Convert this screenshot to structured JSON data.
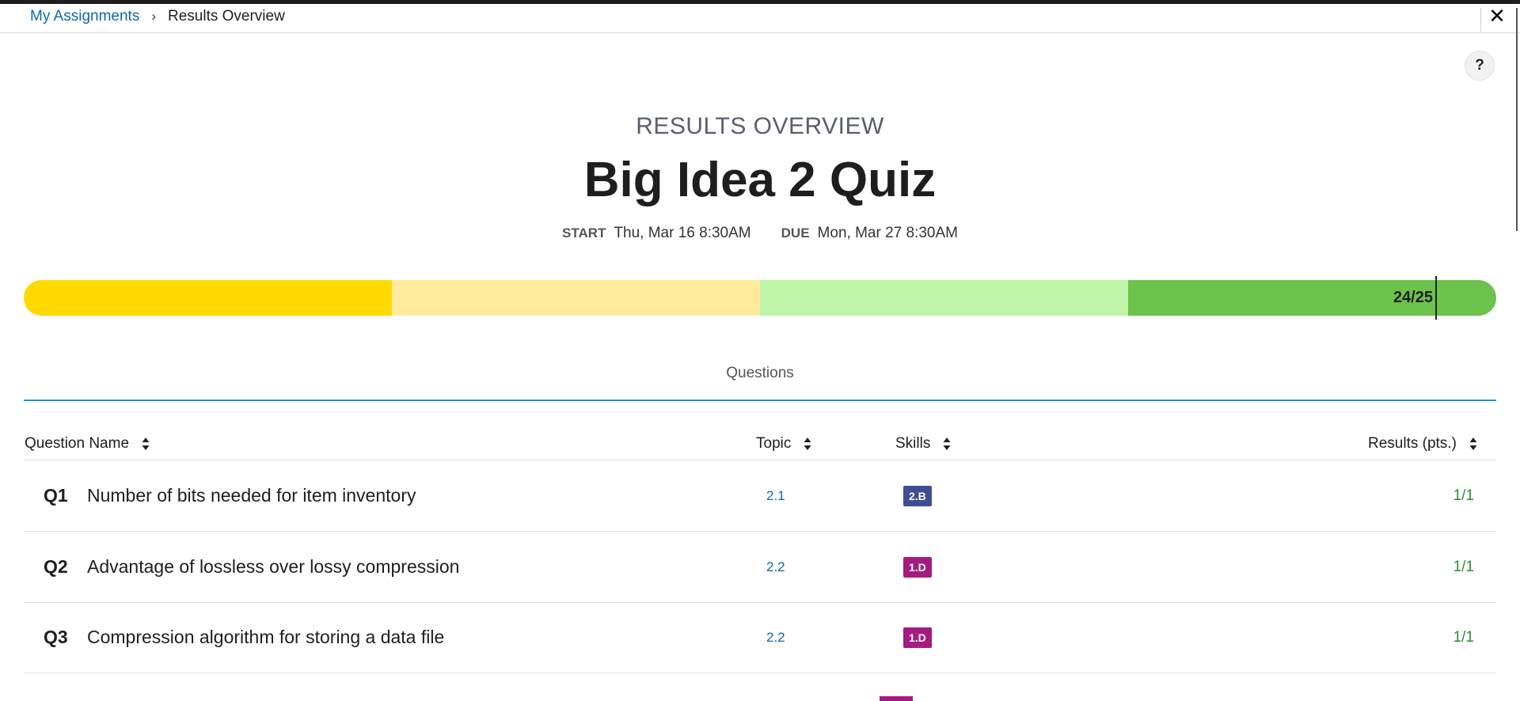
{
  "breadcrumb": {
    "parent": "My Assignments",
    "separator": "›",
    "current": "Results Overview"
  },
  "close_glyph": "✕",
  "help_glyph": "?",
  "header": {
    "eyebrow": "RESULTS OVERVIEW",
    "title": "Big Idea 2 Quiz",
    "start_label": "START",
    "start_value": "Thu, Mar 16 8:30AM",
    "due_label": "DUE",
    "due_value": "Mon, Mar 27 8:30AM"
  },
  "score": {
    "label": "24/25",
    "earned": 24,
    "total": 25,
    "segment_colors": [
      "#ffd900",
      "#ffeb9b",
      "#bef5a8",
      "#6cc24a"
    ]
  },
  "tabs": {
    "questions": "Questions"
  },
  "table": {
    "columns": {
      "name": "Question Name",
      "topic": "Topic",
      "skills": "Skills",
      "results": "Results (pts.)"
    },
    "rows": [
      {
        "num": "Q1",
        "title": "Number of bits needed for item inventory",
        "topic": "2.1",
        "skill": "2.B",
        "skill_color": "#3e4d94",
        "result": "1/1"
      },
      {
        "num": "Q2",
        "title": "Advantage of lossless over lossy compression",
        "topic": "2.2",
        "skill": "1.D",
        "skill_color": "#a61b7f",
        "result": "1/1"
      },
      {
        "num": "Q3",
        "title": "Compression algorithm for storing a data file",
        "topic": "2.2",
        "skill": "1.D",
        "skill_color": "#a61b7f",
        "result": "1/1"
      }
    ]
  },
  "colors": {
    "link": "#0c68b0",
    "accent_rule": "#1e8ad0",
    "result_green": "#2e8d32"
  }
}
